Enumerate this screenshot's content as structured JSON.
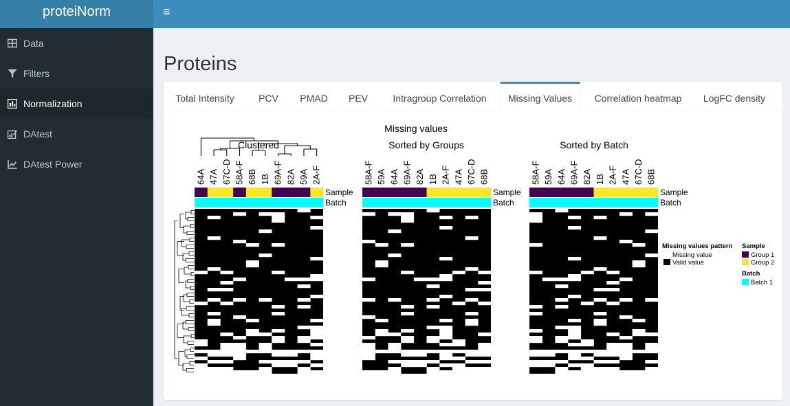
{
  "app": {
    "title": "proteiNorm"
  },
  "sidebar": {
    "items": [
      {
        "label": "Data",
        "icon": "table-icon",
        "active": false
      },
      {
        "label": "Filters",
        "icon": "filter-icon",
        "active": false
      },
      {
        "label": "Normalization",
        "icon": "bar-chart-icon",
        "active": true
      },
      {
        "label": "DAtest",
        "icon": "edit-chart-icon",
        "active": false
      },
      {
        "label": "DAtest Power",
        "icon": "line-chart-icon",
        "active": false
      }
    ]
  },
  "page": {
    "title": "Proteins"
  },
  "tabs": [
    {
      "label": "Total Intensity",
      "active": false
    },
    {
      "label": "PCV",
      "active": false
    },
    {
      "label": "PMAD",
      "active": false
    },
    {
      "label": "PEV",
      "active": false
    },
    {
      "label": "Intragroup Correlation",
      "active": false
    },
    {
      "label": "Missing Values",
      "active": true
    },
    {
      "label": "Correlation heatmap",
      "active": false
    },
    {
      "label": "LogFC density",
      "active": false
    }
  ],
  "figure": {
    "title": "Missing values",
    "panels": [
      {
        "subtitle": "Clustered",
        "samples": [
          "64A",
          "47A",
          "67C-D",
          "58A-F",
          "68B",
          "1B",
          "69A-F",
          "82A",
          "59A",
          "2A-F"
        ],
        "groups": [
          1,
          2,
          2,
          1,
          2,
          2,
          1,
          1,
          1,
          2
        ]
      },
      {
        "subtitle": "Sorted by Groups",
        "samples": [
          "58A-F",
          "59A",
          "64A",
          "69A-F",
          "82A",
          "1B",
          "2A-F",
          "47A",
          "67C-D",
          "68B"
        ],
        "groups": [
          1,
          1,
          1,
          1,
          1,
          2,
          2,
          2,
          2,
          2
        ]
      },
      {
        "subtitle": "Sorted by Batch",
        "samples": [
          "58A-F",
          "59A",
          "64A",
          "69A-F",
          "82A",
          "1B",
          "2A-F",
          "47A",
          "67C-D",
          "68B"
        ],
        "groups": [
          1,
          1,
          1,
          1,
          1,
          2,
          2,
          2,
          2,
          2
        ]
      }
    ],
    "annotation_labels": {
      "sample": "Sample",
      "batch": "Batch"
    },
    "legend": {
      "pattern_title": "Missing values pattern",
      "missing_label": "Missing value",
      "valid_label": "Valid value",
      "sample_title": "Sample",
      "group1_label": "Group 1",
      "group2_label": "Group 2",
      "batch_title": "Batch",
      "batch1_label": "Batch 1"
    },
    "colors": {
      "group1": "#440154",
      "group2": "#fde725",
      "batch1": "#00ffff",
      "valid": "#000000",
      "missing": "#ffffff"
    }
  }
}
